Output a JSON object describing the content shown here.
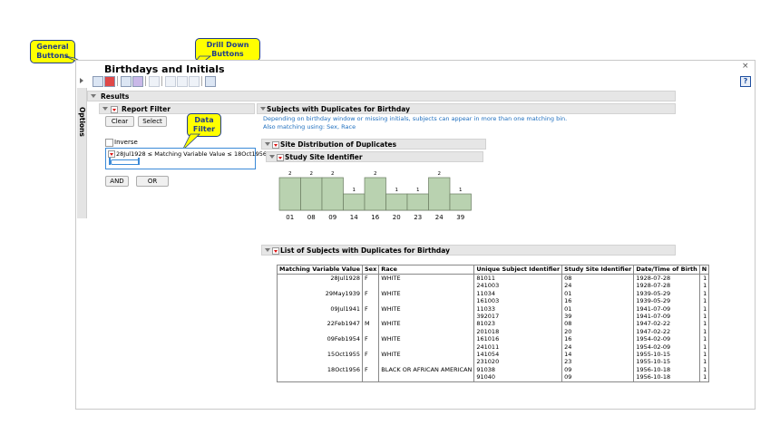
{
  "callouts": {
    "general": "General Buttons",
    "drill": "Drill Down Buttons",
    "filter": "Data Filter"
  },
  "window": {
    "title": "Birthdays and Initials",
    "close": "×",
    "help": "?",
    "options": "Options"
  },
  "results": {
    "label": "Results"
  },
  "report_filter": {
    "title": "Report Filter",
    "clear": "Clear",
    "select": "Select",
    "inverse": "Inverse",
    "condition": "28Jul1928 ≤ Matching Variable Value ≤ 18Oct1956",
    "and": "AND",
    "or": "OR"
  },
  "subjects": {
    "title": "Subjects with Duplicates for Birthday",
    "note1": "Depending on birthday window or missing initials, subjects can appear in more than one matching bin.",
    "note2": "Also matching using: Sex, Race"
  },
  "site_dist": {
    "title": "Site Distribution of Duplicates",
    "subtitle": "Study Site Identifier"
  },
  "chart_data": {
    "type": "bar",
    "categories": [
      "01",
      "08",
      "09",
      "14",
      "16",
      "20",
      "23",
      "24",
      "39"
    ],
    "values": [
      2,
      2,
      2,
      1,
      2,
      1,
      1,
      2,
      1
    ],
    "ylim": [
      0,
      2
    ]
  },
  "list": {
    "title": "List of Subjects with Duplicates for Birthday",
    "columns": [
      "Matching Variable Value",
      "Sex",
      "Race",
      "Unique Subject Identifier",
      "Study Site Identifier",
      "Date/Time of Birth",
      "N"
    ],
    "rows": [
      {
        "mv": "28Jul1928",
        "sex": "F",
        "race": "WHITE",
        "id": "81011",
        "site": "08",
        "dob": "1928-07-28",
        "n": "1"
      },
      {
        "mv": "",
        "sex": "",
        "race": "",
        "id": "241003",
        "site": "24",
        "dob": "1928-07-28",
        "n": "1"
      },
      {
        "mv": "29May1939",
        "sex": "F",
        "race": "WHITE",
        "id": "11034",
        "site": "01",
        "dob": "1939-05-29",
        "n": "1"
      },
      {
        "mv": "",
        "sex": "",
        "race": "",
        "id": "161003",
        "site": "16",
        "dob": "1939-05-29",
        "n": "1"
      },
      {
        "mv": "09Jul1941",
        "sex": "F",
        "race": "WHITE",
        "id": "11033",
        "site": "01",
        "dob": "1941-07-09",
        "n": "1"
      },
      {
        "mv": "",
        "sex": "",
        "race": "",
        "id": "392017",
        "site": "39",
        "dob": "1941-07-09",
        "n": "1"
      },
      {
        "mv": "22Feb1947",
        "sex": "M",
        "race": "WHITE",
        "id": "81023",
        "site": "08",
        "dob": "1947-02-22",
        "n": "1"
      },
      {
        "mv": "",
        "sex": "",
        "race": "",
        "id": "201018",
        "site": "20",
        "dob": "1947-02-22",
        "n": "1"
      },
      {
        "mv": "09Feb1954",
        "sex": "F",
        "race": "WHITE",
        "id": "161016",
        "site": "16",
        "dob": "1954-02-09",
        "n": "1"
      },
      {
        "mv": "",
        "sex": "",
        "race": "",
        "id": "241011",
        "site": "24",
        "dob": "1954-02-09",
        "n": "1"
      },
      {
        "mv": "15Oct1955",
        "sex": "F",
        "race": "WHITE",
        "id": "141054",
        "site": "14",
        "dob": "1955-10-15",
        "n": "1"
      },
      {
        "mv": "",
        "sex": "",
        "race": "",
        "id": "231020",
        "site": "23",
        "dob": "1955-10-15",
        "n": "1"
      },
      {
        "mv": "18Oct1956",
        "sex": "F",
        "race": "BLACK OR AFRICAN AMERICAN",
        "id": "91038",
        "site": "09",
        "dob": "1956-10-18",
        "n": "1"
      },
      {
        "mv": "",
        "sex": "",
        "race": "",
        "id": "91040",
        "site": "09",
        "dob": "1956-10-18",
        "n": "1"
      }
    ]
  },
  "colors": {
    "callout": "#ffff00",
    "callout_text": "#1f3c8a",
    "accent": "#1f6fbf",
    "bar_fill": "#b9d2b0"
  }
}
